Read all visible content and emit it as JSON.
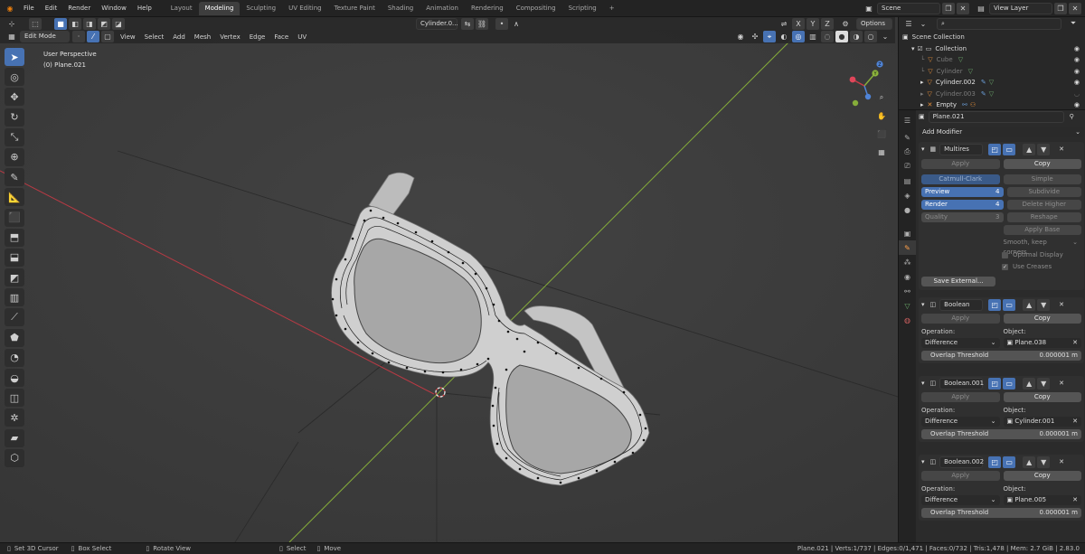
{
  "menubar": {
    "menus": [
      "File",
      "Edit",
      "Render",
      "Window",
      "Help"
    ],
    "workspaces": [
      "Layout",
      "Modeling",
      "Sculpting",
      "UV Editing",
      "Texture Paint",
      "Shading",
      "Animation",
      "Rendering",
      "Compositing",
      "Scripting"
    ],
    "active_workspace": "Modeling",
    "scene": "Scene",
    "view_layer": "View Layer"
  },
  "vp_header": {
    "mode": "Edit Mode",
    "menus": [
      "View",
      "Select",
      "Add",
      "Mesh",
      "Vertex",
      "Edge",
      "Face",
      "UV"
    ],
    "object_field": "Cylinder.0...",
    "axes": [
      "X",
      "Y",
      "Z"
    ],
    "options": "Options"
  },
  "viewport": {
    "perspective": "User Perspective",
    "object": "(0) Plane.021",
    "gizmo_y": "Y",
    "gizmo_z": "Z"
  },
  "outliner": {
    "root": "Scene Collection",
    "collection": "Collection",
    "items": [
      {
        "name": "Cube",
        "dim": true
      },
      {
        "name": "Cylinder",
        "dim": true
      },
      {
        "name": "Cylinder.002",
        "dim": false
      },
      {
        "name": "Cylinder.003",
        "dim": true
      },
      {
        "name": "Empty",
        "dim": false
      }
    ]
  },
  "properties": {
    "object_name": "Plane.021",
    "add_modifier": "Add Modifier",
    "multires": {
      "name": "Multires",
      "apply": "Apply",
      "copy": "Copy",
      "catmull": "Catmull-Clark",
      "simple": "Simple",
      "preview_label": "Preview",
      "preview_value": "4",
      "subdivide": "Subdivide",
      "render_label": "Render",
      "render_value": "4",
      "delete_higher": "Delete Higher",
      "quality_label": "Quality",
      "quality_value": "3",
      "reshape": "Reshape",
      "apply_base": "Apply Base",
      "uv_option": "Smooth, keep corners",
      "optimal_display": "Optimal Display",
      "use_creases": "Use Creases",
      "save_external": "Save External..."
    },
    "booleans": [
      {
        "name": "Boolean",
        "operation_label": "Operation:",
        "object_label": "Object:",
        "operation": "Difference",
        "object": "Plane.038",
        "overlap_label": "Overlap Threshold",
        "overlap": "0.000001 m",
        "apply": "Apply",
        "copy": "Copy"
      },
      {
        "name": "Boolean.001",
        "operation_label": "Operation:",
        "object_label": "Object:",
        "operation": "Difference",
        "object": "Cylinder.001",
        "overlap_label": "Overlap Threshold",
        "overlap": "0.000001 m",
        "apply": "Apply",
        "copy": "Copy"
      },
      {
        "name": "Boolean.002",
        "operation_label": "Operation:",
        "object_label": "Object:",
        "operation": "Difference",
        "object": "Plane.005",
        "overlap_label": "Overlap Threshold",
        "overlap": "0.000001 m",
        "apply": "Apply",
        "copy": "Copy"
      }
    ]
  },
  "statusbar": {
    "set_cursor": "Set 3D Cursor",
    "box_select": "Box Select",
    "rotate_view": "Rotate View",
    "select": "Select",
    "move": "Move",
    "stats": "Plane.021 | Verts:1/737 | Edges:0/1,471 | Faces:0/732 | Tris:1,478 | Mem: 2.7 GiB | 2.83.0"
  },
  "colors": {
    "accent": "#4772b3",
    "x_axis": "#c83c48",
    "y_axis": "#8cb43c",
    "active_tab": "#ffa04a"
  }
}
